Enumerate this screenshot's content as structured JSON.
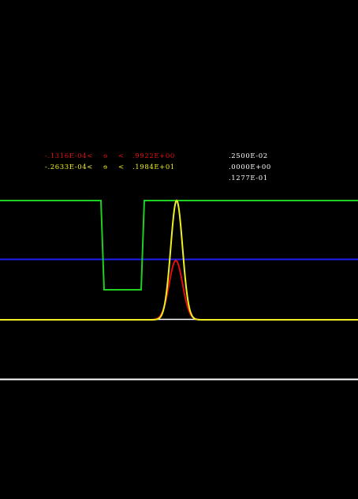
{
  "colors": {
    "background": "#000000",
    "red": "#e01010",
    "yellow": "#f0f020",
    "green": "#20d020",
    "blue": "#2020f0",
    "white": "#ffffff"
  },
  "range_rows": [
    {
      "color_key": "red",
      "low": "-.1316E-04<",
      "symbol": "ɘ",
      "lt": "<",
      "high": ".9922E+00"
    },
    {
      "color_key": "yellow",
      "low": "-.2633E-04<",
      "symbol": "ɘ",
      "lt": "<",
      "high": ".1984E+01"
    }
  ],
  "parameters": [
    ".2500E-02",
    ".0000E+00",
    ".1277E-01"
  ]
}
